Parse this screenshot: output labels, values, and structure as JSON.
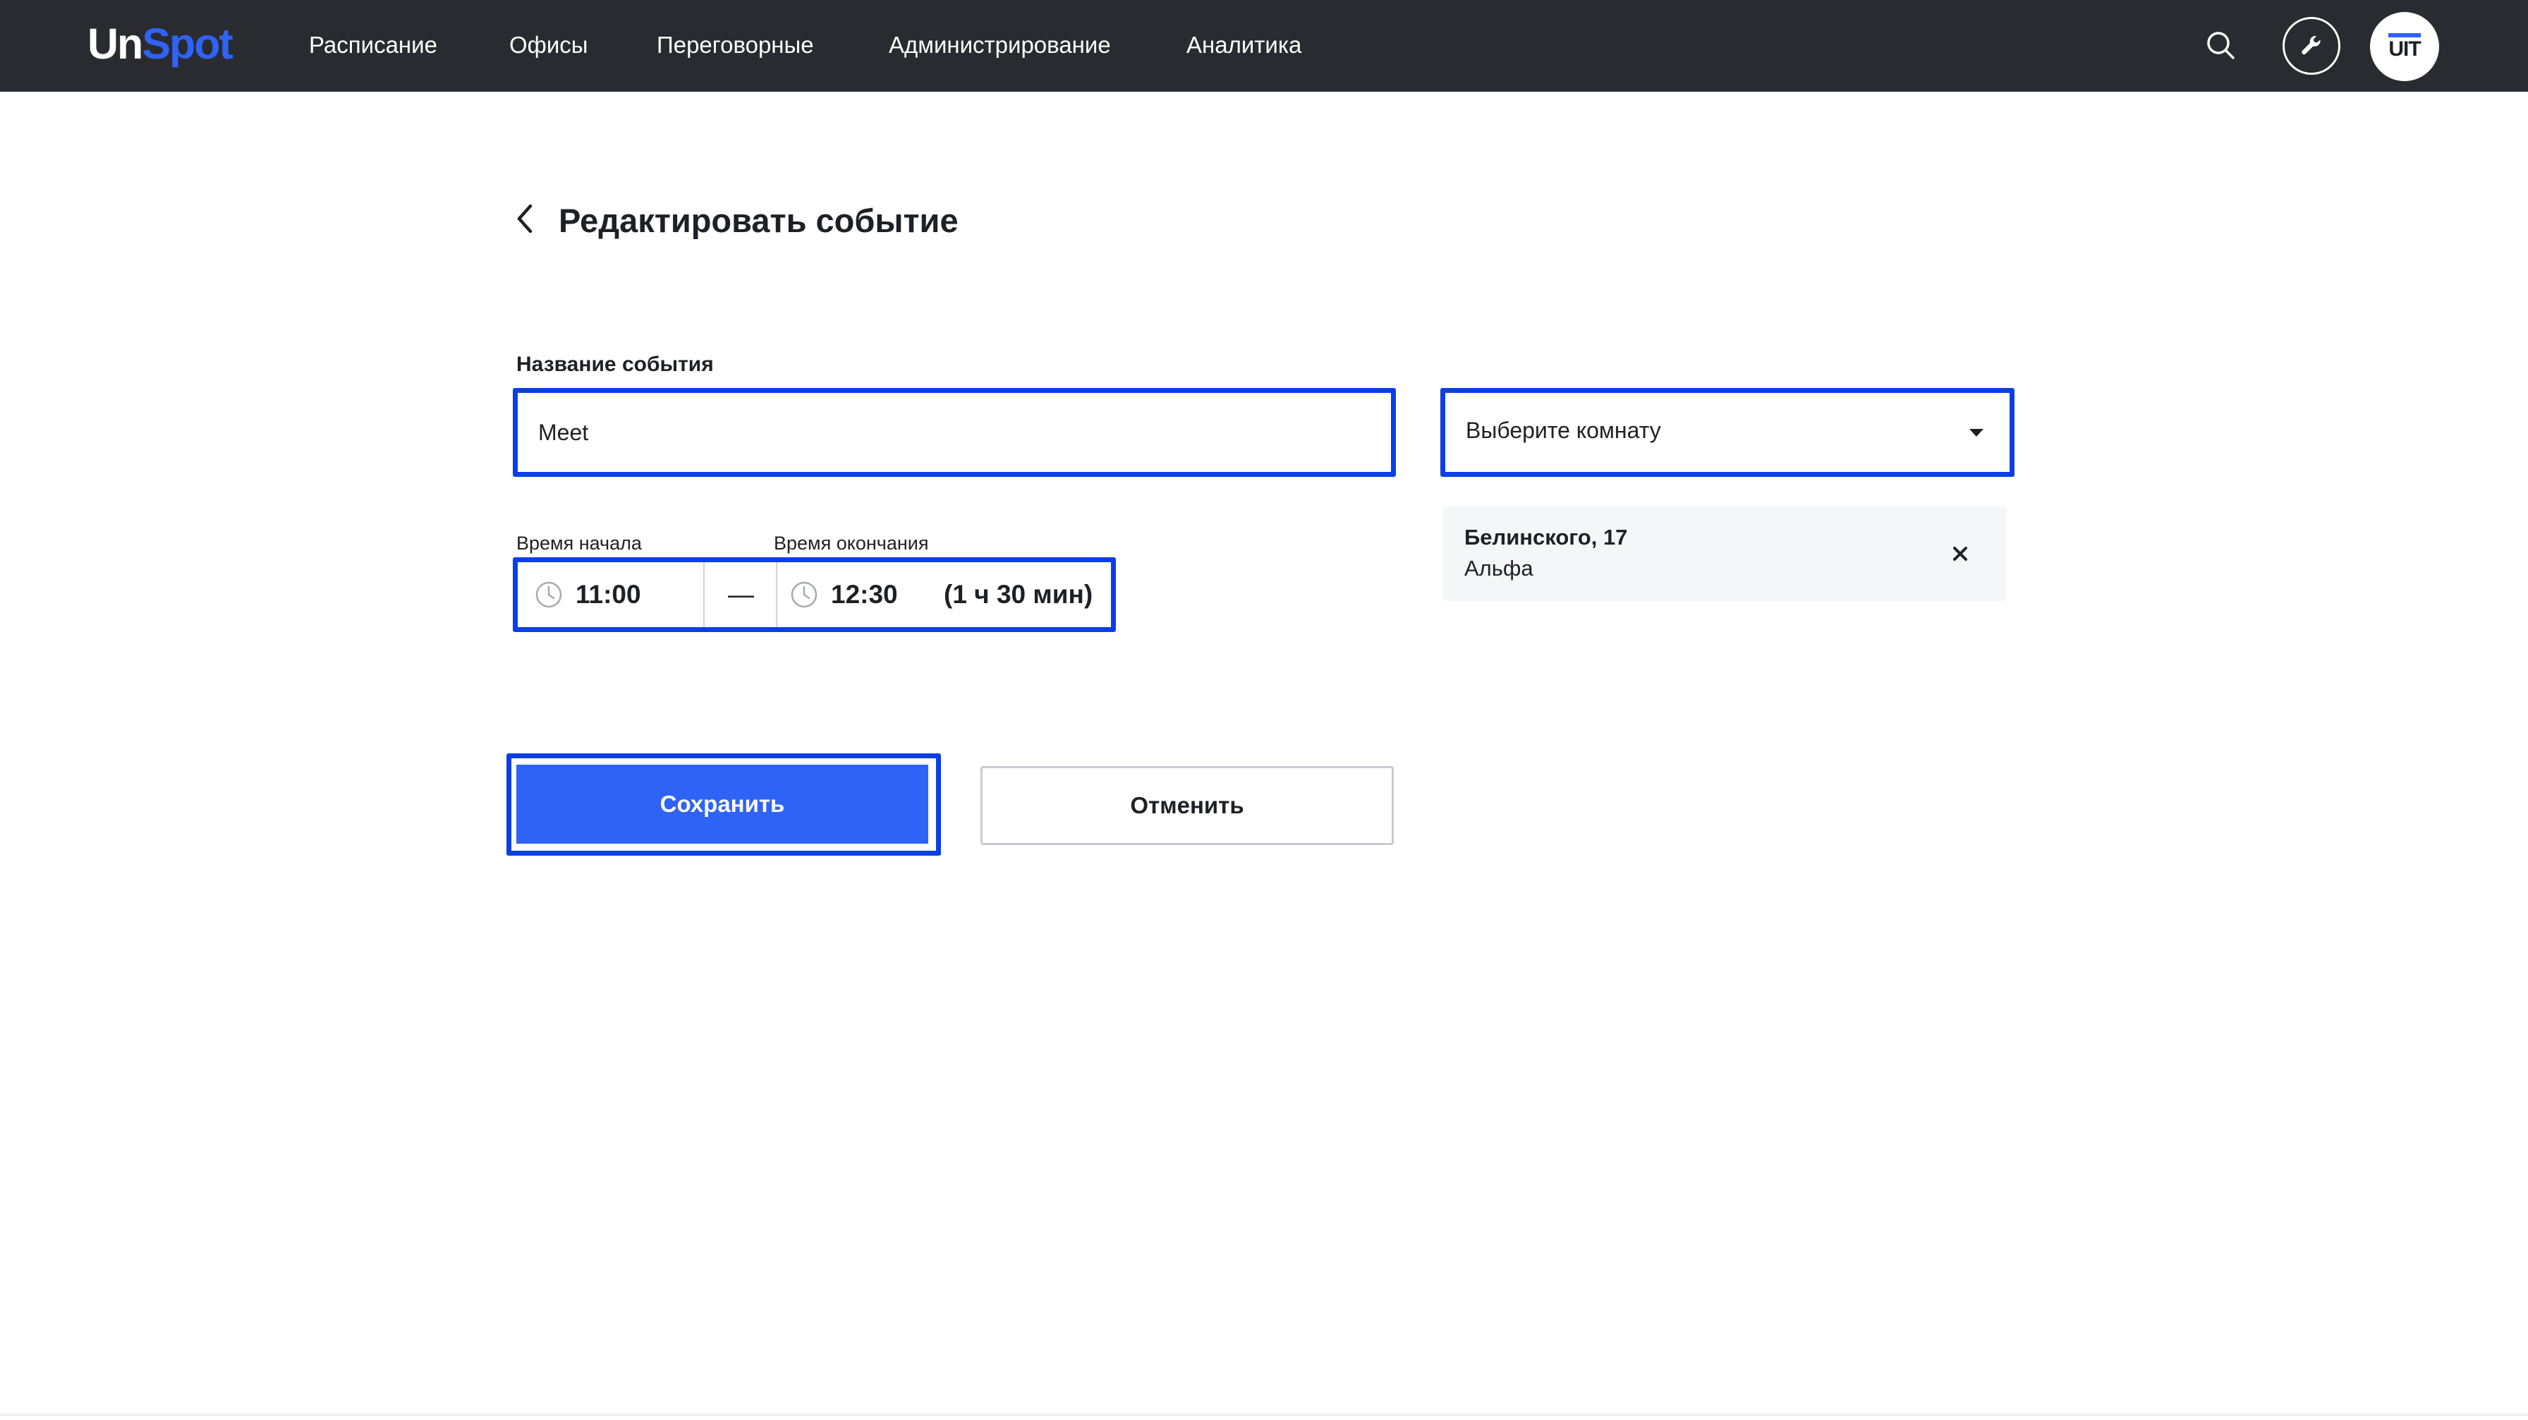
{
  "brand": {
    "part1": "Un",
    "part2": "Spot",
    "accent": "#2e63f5"
  },
  "nav": {
    "items": [
      {
        "label": "Расписание"
      },
      {
        "label": "Офисы"
      },
      {
        "label": "Переговорные"
      },
      {
        "label": "Администрирование"
      },
      {
        "label": "Аналитика"
      }
    ],
    "icons": [
      "search-icon",
      "wrench-icon"
    ],
    "avatar_text": "UIT"
  },
  "page": {
    "title": "Редактировать событие",
    "back_icon": "chevron-left-icon"
  },
  "form": {
    "event_name_label": "Название события",
    "event_name_value": "Meet",
    "room_select_placeholder": "Выберите комнату",
    "start_label": "Время начала",
    "end_label": "Время окончания",
    "start_time": "11:00",
    "separator": "—",
    "end_time": "12:30",
    "duration": "(1 ч 30 мин)"
  },
  "location": {
    "address": "Белинского, 17",
    "room": "Альфа",
    "remove_icon": "close-icon"
  },
  "actions": {
    "save_label": "Сохранить",
    "cancel_label": "Отменить"
  },
  "colors": {
    "topbar": "#2a2b30",
    "primary": "#2e63f5",
    "highlight": "#0b3fe6"
  }
}
